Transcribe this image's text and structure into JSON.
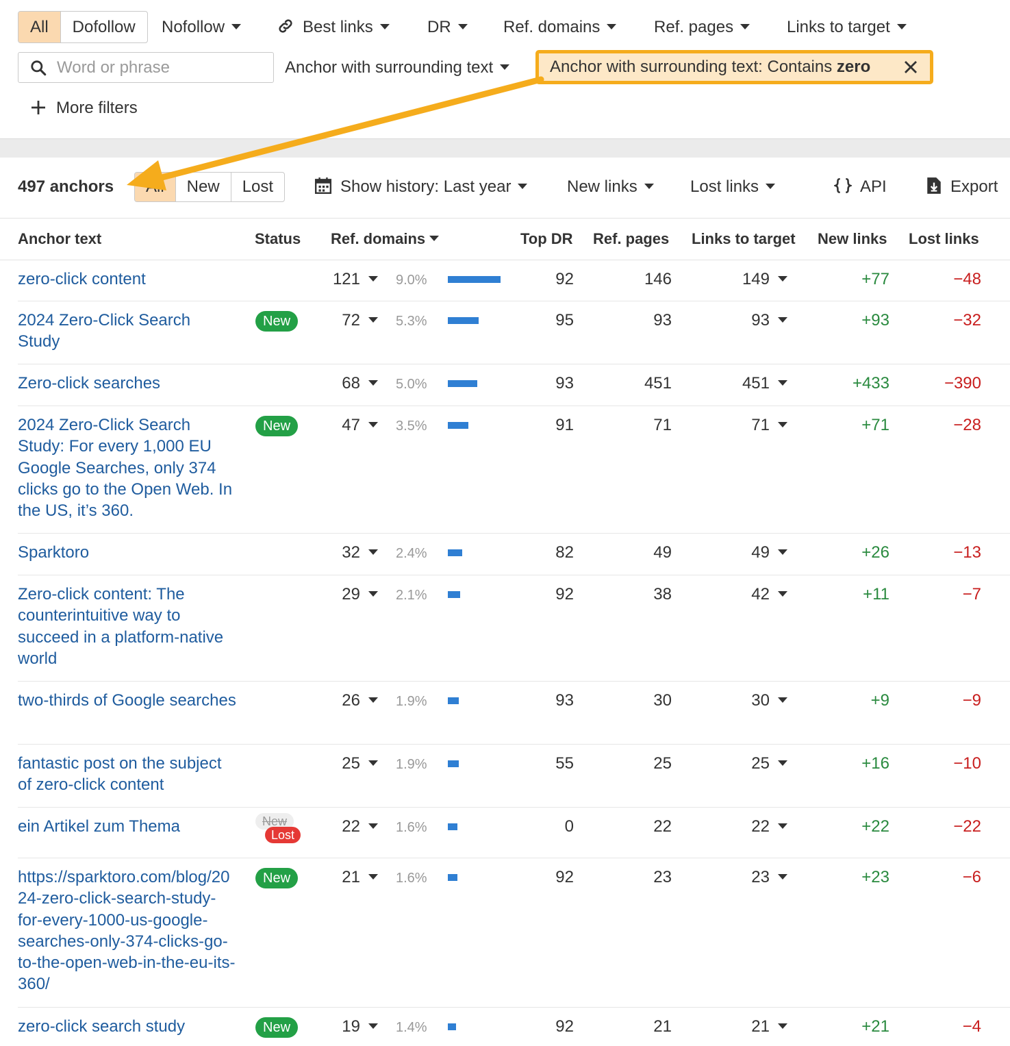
{
  "filters": {
    "segment": [
      "All",
      "Dofollow"
    ],
    "nofollow": "Nofollow",
    "best_links": "Best links",
    "dr": "DR",
    "ref_domains": "Ref. domains",
    "ref_pages": "Ref. pages",
    "links_to_target": "Links to target",
    "search_placeholder": "Word or phrase",
    "anchor_surrounding": "Anchor with surrounding text",
    "chip_prefix": "Anchor with surrounding text: Contains ",
    "chip_value": "zero",
    "more_filters": "More filters"
  },
  "toolbar": {
    "count": "497 anchors",
    "tabs": [
      "All",
      "New",
      "Lost"
    ],
    "show_history": "Show history: Last year",
    "new_links": "New links",
    "lost_links": "Lost links",
    "api": "API",
    "export": "Export"
  },
  "table": {
    "headers": {
      "anchor_text": "Anchor text",
      "status": "Status",
      "ref_domains": "Ref. domains",
      "top_dr": "Top DR",
      "ref_pages": "Ref. pages",
      "links_to_target": "Links to target",
      "new_links": "New links",
      "lost_links": "Lost links"
    },
    "rows": [
      {
        "anchor": "zero-click content",
        "status": "",
        "ref_domains": "121",
        "pct": "9.0%",
        "share": 9.0,
        "top_dr": "92",
        "ref_pages": "146",
        "links": "149",
        "new": "+77",
        "lost": "−48"
      },
      {
        "anchor": "2024 Zero-Click Search Study",
        "status": "New",
        "ref_domains": "72",
        "pct": "5.3%",
        "share": 5.3,
        "top_dr": "95",
        "ref_pages": "93",
        "links": "93",
        "new": "+93",
        "lost": "−32"
      },
      {
        "anchor": "Zero-click searches",
        "status": "",
        "ref_domains": "68",
        "pct": "5.0%",
        "share": 5.0,
        "top_dr": "93",
        "ref_pages": "451",
        "links": "451",
        "new": "+433",
        "lost": "−390"
      },
      {
        "anchor": "2024 Zero-Click Search Study: For every 1,000 EU Google Searches, only 374 clicks go to the Open Web. In the US, it’s 360.",
        "status": "New",
        "ref_domains": "47",
        "pct": "3.5%",
        "share": 3.5,
        "top_dr": "91",
        "ref_pages": "71",
        "links": "71",
        "new": "+71",
        "lost": "−28"
      },
      {
        "anchor": "Sparktoro",
        "status": "",
        "ref_domains": "32",
        "pct": "2.4%",
        "share": 2.4,
        "top_dr": "82",
        "ref_pages": "49",
        "links": "49",
        "new": "+26",
        "lost": "−13"
      },
      {
        "anchor": "Zero-click content: The counterintuitive way to succeed in a platform-native world",
        "status": "",
        "ref_domains": "29",
        "pct": "2.1%",
        "share": 2.1,
        "top_dr": "92",
        "ref_pages": "38",
        "links": "42",
        "new": "+11",
        "lost": "−7"
      },
      {
        "anchor": "two-thirds of Google searches",
        "status": "",
        "ref_domains": "26",
        "pct": "1.9%",
        "share": 1.9,
        "top_dr": "93",
        "ref_pages": "30",
        "links": "30",
        "new": "+9",
        "lost": "−9"
      },
      {
        "anchor": "fantastic post on the subject of zero-click content",
        "status": "",
        "ref_domains": "25",
        "pct": "1.9%",
        "share": 1.9,
        "top_dr": "55",
        "ref_pages": "25",
        "links": "25",
        "new": "+16",
        "lost": "−10"
      },
      {
        "anchor": "ein Artikel zum Thema",
        "status": "New/Lost",
        "status_struck": "New",
        "status_lost": "Lost",
        "ref_domains": "22",
        "pct": "1.6%",
        "share": 1.6,
        "top_dr": "0",
        "ref_pages": "22",
        "links": "22",
        "new": "+22",
        "lost": "−22"
      },
      {
        "anchor": "https://sparktoro.com/blog/2024-zero-click-search-study-for-every-1000-us-google-searches-only-374-clicks-go-to-the-open-web-in-the-eu-its-360/",
        "status": "New",
        "ref_domains": "21",
        "pct": "1.6%",
        "share": 1.6,
        "top_dr": "92",
        "ref_pages": "23",
        "links": "23",
        "new": "+23",
        "lost": "−6"
      },
      {
        "anchor": "zero-click search study",
        "status": "New",
        "ref_domains": "19",
        "pct": "1.4%",
        "share": 1.4,
        "top_dr": "92",
        "ref_pages": "21",
        "links": "21",
        "new": "+21",
        "lost": "−4"
      }
    ]
  },
  "colors": {
    "accent_orange": "#f5ac1c",
    "active_segment": "#fbd9b0",
    "link_blue": "#1f5c9e",
    "bar_blue": "#2f7fd3",
    "positive_green": "#2a8a3f",
    "negative_red": "#c81e1e",
    "badge_new": "#23a046",
    "badge_lost": "#e53935"
  }
}
